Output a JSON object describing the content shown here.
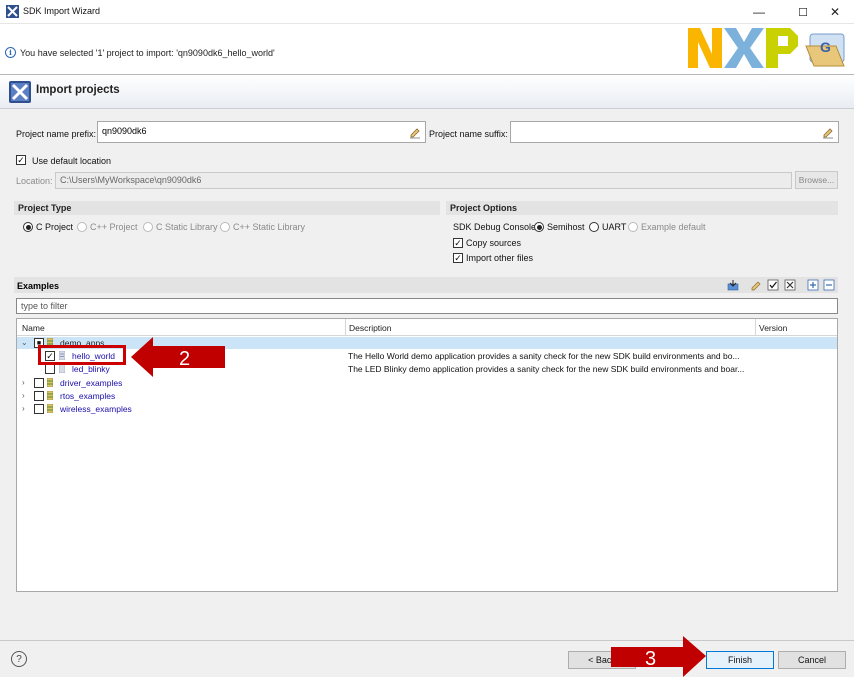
{
  "window": {
    "title": "SDK Import Wizard",
    "minimize": "—",
    "maximize": "☐",
    "close": "✕"
  },
  "banner": {
    "info_text": "You have selected '1' project to import: 'qn9090dk6_hello_world'",
    "logo_letters": "NXP"
  },
  "section": {
    "title": "Import projects"
  },
  "form": {
    "prefix_label": "Project name prefix:",
    "prefix_value": "qn9090dk6",
    "suffix_label": "Project name suffix:",
    "suffix_value": "",
    "use_default_label": "Use default location",
    "use_default_checked": true,
    "location_label": "Location:",
    "location_value": "C:\\Users\\MyWorkspace\\qn9090dk6",
    "browse_label": "Browse..."
  },
  "project_type": {
    "title": "Project Type",
    "options": [
      "C Project",
      "C++ Project",
      "C Static Library",
      "C++ Static Library"
    ],
    "selected": "C Project"
  },
  "project_options": {
    "title": "Project Options",
    "debug_console_label": "SDK Debug Console",
    "console_options": [
      "Semihost",
      "UART",
      "Example default"
    ],
    "console_selected": "Semihost",
    "copy_sources_label": "Copy sources",
    "copy_sources_checked": true,
    "import_other_label": "Import other files",
    "import_other_checked": true
  },
  "examples": {
    "title": "Examples",
    "filter_placeholder": "type to filter",
    "columns": [
      "Name",
      "Description",
      "Version"
    ],
    "tree": {
      "demo_apps": "demo_apps",
      "hello_world": "hello_world",
      "hello_world_desc": "The Hello World demo application provides a sanity check for the new SDK build environments and bo...",
      "led_blinky": "led_blinky",
      "led_blinky_desc": "The LED Blinky demo application provides a sanity check for the new SDK build environments and boar...",
      "driver_examples": "driver_examples",
      "rtos_examples": "rtos_examples",
      "wireless_examples": "wireless_examples"
    }
  },
  "annotations": {
    "step2": "2",
    "step3": "3"
  },
  "buttons": {
    "help": "?",
    "back": "< Back",
    "finish": "Finish",
    "cancel": "Cancel"
  },
  "colors": {
    "accent_blue": "#0078d7",
    "annotation_red": "#c00000",
    "selection": "#cce4f7",
    "nxp_orange": "#f9b500",
    "nxp_green": "#c9d200",
    "nxp_blue": "#7bb1db"
  }
}
